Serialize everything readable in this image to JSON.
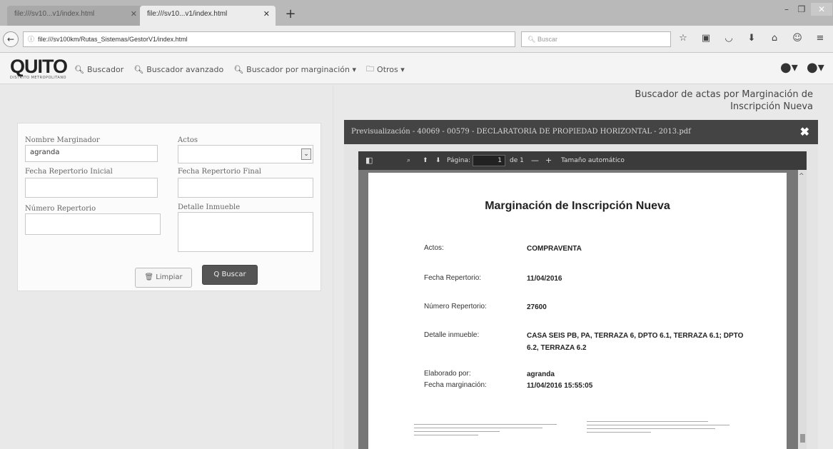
{
  "browser": {
    "tabs": [
      {
        "label": "file:///sv10...v1/index.html"
      },
      {
        "label": "file:///sv10...v1/index.html"
      }
    ],
    "new_tab": "+",
    "url": "file:///sv100km/Rutas_Sistemas/GestorV1/index.html",
    "search_placeholder": "Buscar",
    "win_min": "–",
    "win_max": "❐",
    "win_close": "✕"
  },
  "app": {
    "logo": "QUITO",
    "logo_sub": "DISTRITO METROPOLITANO",
    "menu": [
      {
        "label": "Buscador",
        "icon": "search-icon"
      },
      {
        "label": "Buscador avanzado",
        "icon": "search-plus-icon"
      },
      {
        "label": "Buscador por marginación ▾",
        "icon": "search-plus-icon"
      },
      {
        "label": "Otros ▾",
        "icon": "folder-icon"
      }
    ]
  },
  "page": {
    "title_line1": "Buscador de actas por Marginación de",
    "title_line2": "Inscripción Nueva"
  },
  "form": {
    "nombre_label": "Nombre Marginador",
    "nombre_value": "agranda",
    "actos_label": "Actos",
    "actos_value": "",
    "fecha_ini_label": "Fecha Repertorio Inicial",
    "fecha_ini_value": "",
    "fecha_fin_label": "Fecha Repertorio Final",
    "fecha_fin_value": "",
    "numero_label": "Número Repertorio",
    "numero_value": "",
    "detalle_label": "Detalle Inmueble",
    "detalle_value": "",
    "clear_label": "🗑 Limpiar",
    "search_label": "Q Buscar"
  },
  "preview": {
    "header": "Previsualización - 40069 - 00579 - DECLARATORIA DE PROPIEDAD HORIZONTAL - 2013.pdf",
    "close": "✖",
    "toolbar": {
      "page_label": "Página:",
      "page_value": "1",
      "page_of": "de 1",
      "zoom_label": "Tamaño automático"
    },
    "doc": {
      "title": "Marginación de Inscripción Nueva",
      "actos_label": "Actos:",
      "actos_value": "COMPRAVENTA",
      "fecha_label": "Fecha Repertorio:",
      "fecha_value": "11/04/2016",
      "numero_label": "Número Repertorio:",
      "numero_value": "27600",
      "detalle_label": "Detalle inmueble:",
      "detalle_value": "CASA SEIS PB, PA, TERRAZA 6, DPTO 6.1, TERRAZA 6.1; DPTO 6.2, TERRAZA 6.2",
      "elaborado_label": "Elaborado por:",
      "elaborado_value": "agranda",
      "fecha_marg_label": "Fecha marginación:",
      "fecha_marg_value": "11/04/2016 15:55:05"
    }
  }
}
